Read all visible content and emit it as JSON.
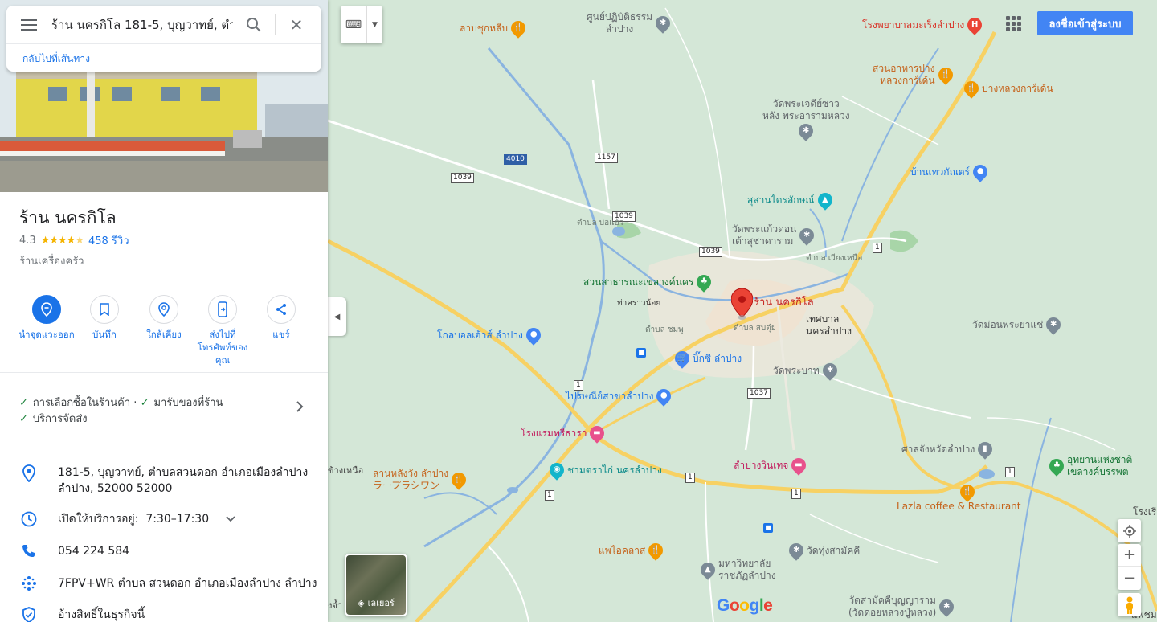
{
  "search": {
    "query": "ร้าน นครกิโล 181-5, บุญวาทย์, ตำบล",
    "back_link": "กลับไปที่เส้นทาง"
  },
  "place": {
    "name": "ร้าน นครกิโล",
    "rating": "4.3",
    "rating_value": 4.3,
    "reviews": "458 รีวิว",
    "category": "ร้านเครื่องครัว"
  },
  "actions": [
    {
      "label": "นำจุดแวะออก",
      "icon": "remove-stop-icon"
    },
    {
      "label": "บันทึก",
      "icon": "bookmark-icon"
    },
    {
      "label": "ใกล้เคียง",
      "icon": "nearby-icon"
    },
    {
      "label": "ส่งไปที่โทรศัพท์ของคุณ",
      "icon": "send-to-phone-icon"
    },
    {
      "label": "แชร์",
      "icon": "share-icon"
    }
  ],
  "service_options": {
    "line1a": "การเลือกซื้อในร้านค้า ·",
    "line1b": "มารับของที่ร้าน",
    "line2": "บริการจัดส่ง"
  },
  "details": {
    "address_line1": "181-5, บุญวาทย์, ตำบลสวนดอก อำเภอเมืองลำปาง",
    "address_line2": "ลำปาง, 52000 52000",
    "hours_status": "เปิดให้บริการอยู่:",
    "hours": "7:30–17:30",
    "phone": "054 224 584",
    "plus_code": "7FPV+WR ตำบล สวนดอก อำเภอเมืองลำปาง ลำปาง",
    "claim": "อ้างสิทธิ์ในธุรกิจนี้"
  },
  "map": {
    "signin": "ลงชื่อเข้าสู่ระบบ",
    "layers_label": "เลเยอร์",
    "google_logo": "Google",
    "marker_label": "ร้าน นครกิโล",
    "city_label": "เทศบาล\nนครลำปาง",
    "pois": {
      "p1": "ศูนย์ปฏิบัติธรรม\nลำปาง",
      "p2": "ลาบชุกหลีบ",
      "p3": "โรงพยาบาลมะเร็งลำปาง",
      "p4": "สวนอาหารปาง\nหลวงการ์เด้น",
      "p5": "ปางหลวงการ์เด้น",
      "p6": "วัดพระเจดีย์ซาว\nหลัง พระอารามหลวง",
      "p7": "บ้านเทวกัณตร์",
      "p8": "สุสานไตรลักษณ์",
      "p9": "วัดพระแก้วดอน\nเต้าสุชาดาราม",
      "p10": "สวนสาธารณะเขลางค์นคร",
      "p11": "โกลบอลเฮ้าส์ ลำปาง",
      "p12": "บิ๊กซี ลำปาง",
      "p13": "วัดม่อนพระยาแช่",
      "p14": "วัดพระบาท",
      "p15": "ไปรษณีย์สาขาลำปาง",
      "p16": "โรงแรมทรีธารา",
      "p17": "ศาลจังหวัดลำปาง",
      "p18": "อุทยานแห่งชาติ\nเขลางค์บรรพต",
      "p19": "ลำปางวินเทจ",
      "p20": "Lazla coffee & Restaurant",
      "p21": "ลานหลังวัง ลำปาง\nラープラシワン",
      "p22": "ชามตราไก่ นครลำปาง",
      "p23": "แพไอคลาส",
      "p24": "วัดทุ่งสามัคคี",
      "p25": "มหาวิทยาลัย\nราชภัฏลำปาง",
      "p26": "วัดสามัคคีบุญญาราม\n(วัดดอยหลวงปู่หลวง)",
      "p27": "โรงเรียน",
      "p28": "แพชมชมวิว",
      "p29": "ท่าคราวน้อย",
      "p30": "ข้างเหนือ",
      "p31": "งจ้ำ"
    },
    "small_labels": {
      "t1": "ตำบล\nบ่อแฮ้ว",
      "t2": "ตำบล\nเวียงเหนือ",
      "t3": "ตำบล\nสบตุ๋ย",
      "t4": "ตำบล\nชมพู"
    },
    "shields": {
      "s4010": "4010",
      "s1157": "1157",
      "s1039a": "1039",
      "s1039b": "1039",
      "s1039c": "1039",
      "s1a": "1",
      "s1b": "1",
      "s1c": "1",
      "s1d": "1",
      "s1e": "1",
      "s1f": "1",
      "s1037": "1037"
    }
  }
}
